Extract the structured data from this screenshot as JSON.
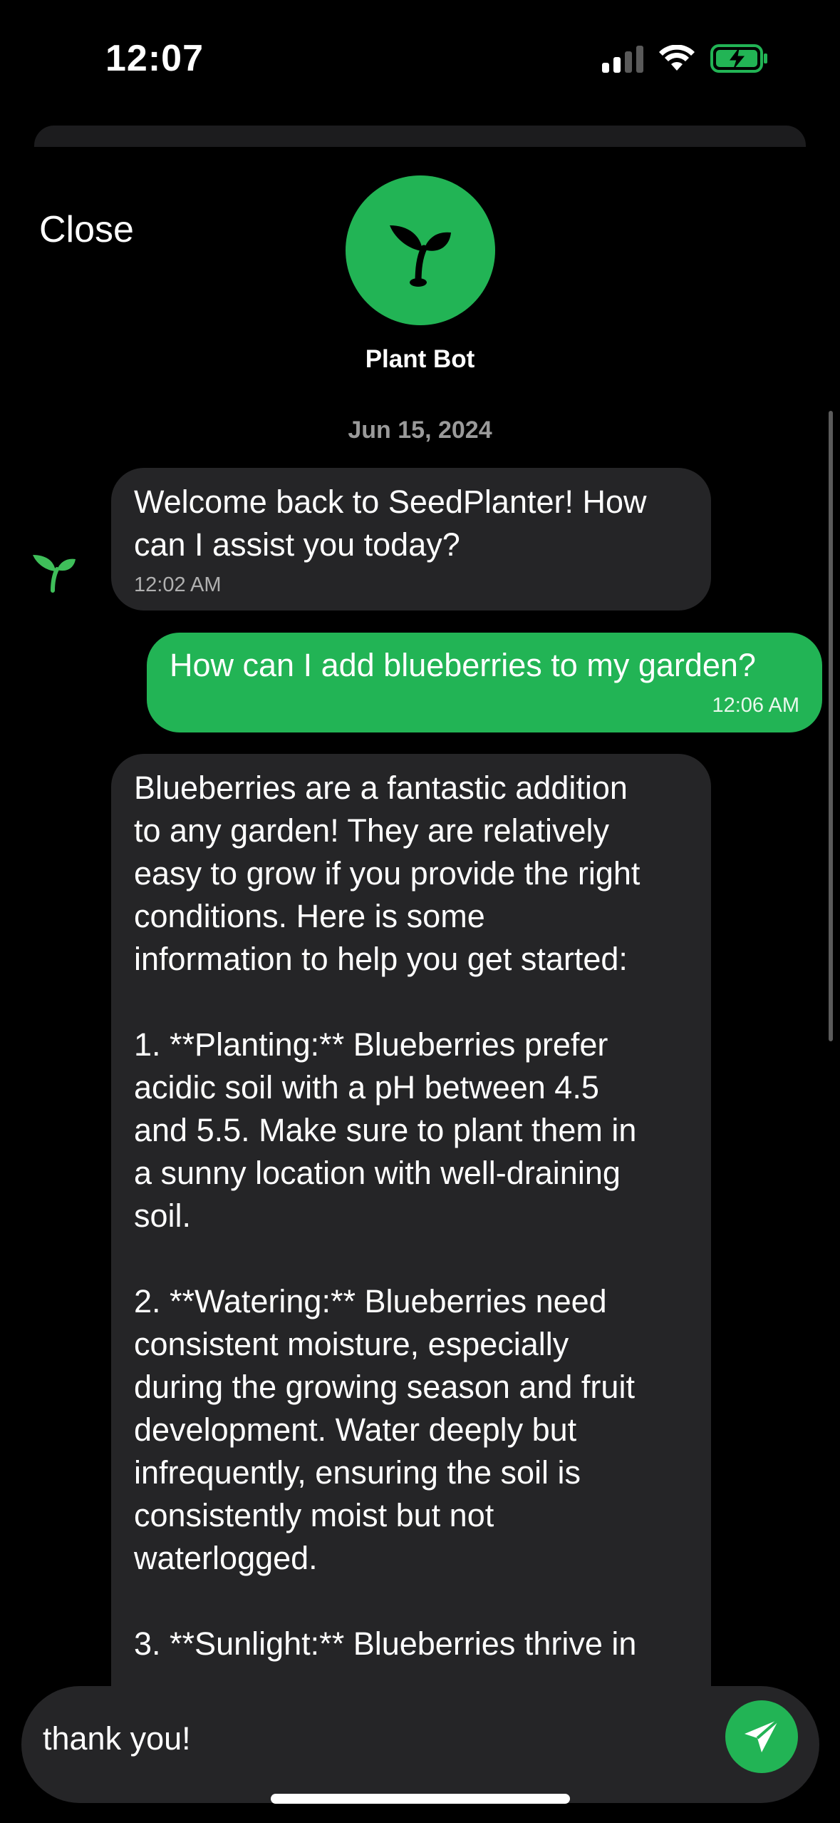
{
  "status_bar": {
    "time": "12:07"
  },
  "header": {
    "close_label": "Close",
    "bot_name": "Plant Bot",
    "date": "Jun 15, 2024"
  },
  "messages": [
    {
      "sender": "bot",
      "text": "Welcome back to SeedPlanter! How\ncan I assist you today?",
      "time": "12:02 AM"
    },
    {
      "sender": "user",
      "text": "How can I add blueberries to my garden?",
      "time": "12:06 AM"
    },
    {
      "sender": "bot",
      "text": "Blueberries are a fantastic addition\nto any garden! They are relatively\neasy to grow if you provide the right\nconditions. Here is some\ninformation to help you get started:\n\n1. **Planting:** Blueberries prefer\nacidic soil with a pH between 4.5\nand 5.5. Make sure to plant them in\na sunny location with well-draining\nsoil.\n\n2. **Watering:** Blueberries need\nconsistent moisture, especially\nduring the growing season and fruit\ndevelopment. Water deeply but\ninfrequently, ensuring the soil is\nconsistently moist but not\nwaterlogged.\n\n3. **Sunlight:** Blueberries thrive in"
    }
  ],
  "composer": {
    "value": "thank you!"
  },
  "colors": {
    "accent": "#22b455",
    "bubble_bot": "#252527",
    "background": "#000000"
  },
  "icons": {
    "bot": "sprout-icon",
    "send": "paper-plane-icon"
  }
}
